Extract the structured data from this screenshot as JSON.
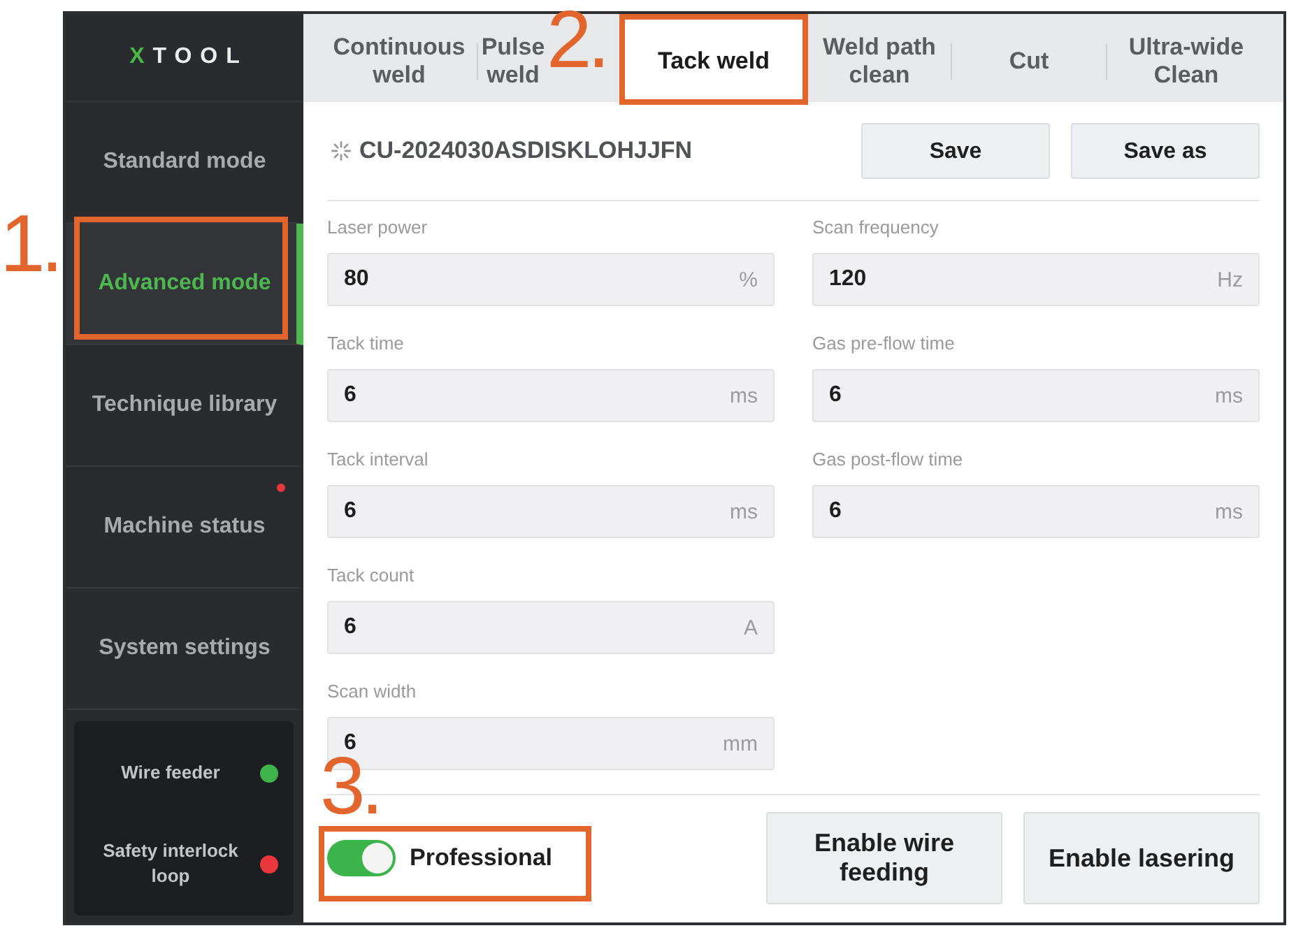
{
  "logo": {
    "text": "XTOOL"
  },
  "sidebar": {
    "items": [
      {
        "label": "Standard mode",
        "selected": false,
        "alert": false
      },
      {
        "label": "Advanced mode",
        "selected": true,
        "alert": false
      },
      {
        "label": "Technique library",
        "selected": false,
        "alert": false
      },
      {
        "label": "Machine status",
        "selected": false,
        "alert": true
      },
      {
        "label": "System settings",
        "selected": false,
        "alert": false
      }
    ]
  },
  "status_panel": {
    "items": [
      {
        "label": "Wire feeder",
        "color": "#3db54a"
      },
      {
        "label": "Safety interlock loop",
        "color": "#e8383d"
      }
    ]
  },
  "tabs": [
    {
      "label": "Continuous weld",
      "selected": false
    },
    {
      "label": "Pulse weld",
      "selected": false
    },
    {
      "label": "Tack weld",
      "selected": true
    },
    {
      "label": "Weld path clean",
      "selected": false
    },
    {
      "label": "Cut",
      "selected": false
    },
    {
      "label": "Ultra-wide Clean",
      "selected": false
    }
  ],
  "preset": {
    "name": "CU-2024030ASDISKLOHJJFN",
    "buttons": [
      "Save",
      "Save as"
    ]
  },
  "parameters": {
    "left": [
      {
        "label": "Laser power",
        "value": "80",
        "unit": "%"
      },
      {
        "label": "Tack time",
        "value": "6",
        "unit": "ms"
      },
      {
        "label": "Tack interval",
        "value": "6",
        "unit": "ms"
      },
      {
        "label": "Tack count",
        "value": "6",
        "unit": "A"
      },
      {
        "label": "Scan width",
        "value": "6",
        "unit": "mm"
      }
    ],
    "right": [
      {
        "label": "Scan frequency",
        "value": "120",
        "unit": "Hz"
      },
      {
        "label": "Gas pre-flow time",
        "value": "6",
        "unit": "ms"
      },
      {
        "label": "Gas post-flow time",
        "value": "6",
        "unit": "ms"
      }
    ]
  },
  "professional": {
    "label": "Professional",
    "on": true
  },
  "action_buttons": [
    "Enable wire feeding",
    "Enable lasering"
  ],
  "annotations": [
    {
      "label": "1."
    },
    {
      "label": "2."
    },
    {
      "label": "3."
    }
  ]
}
